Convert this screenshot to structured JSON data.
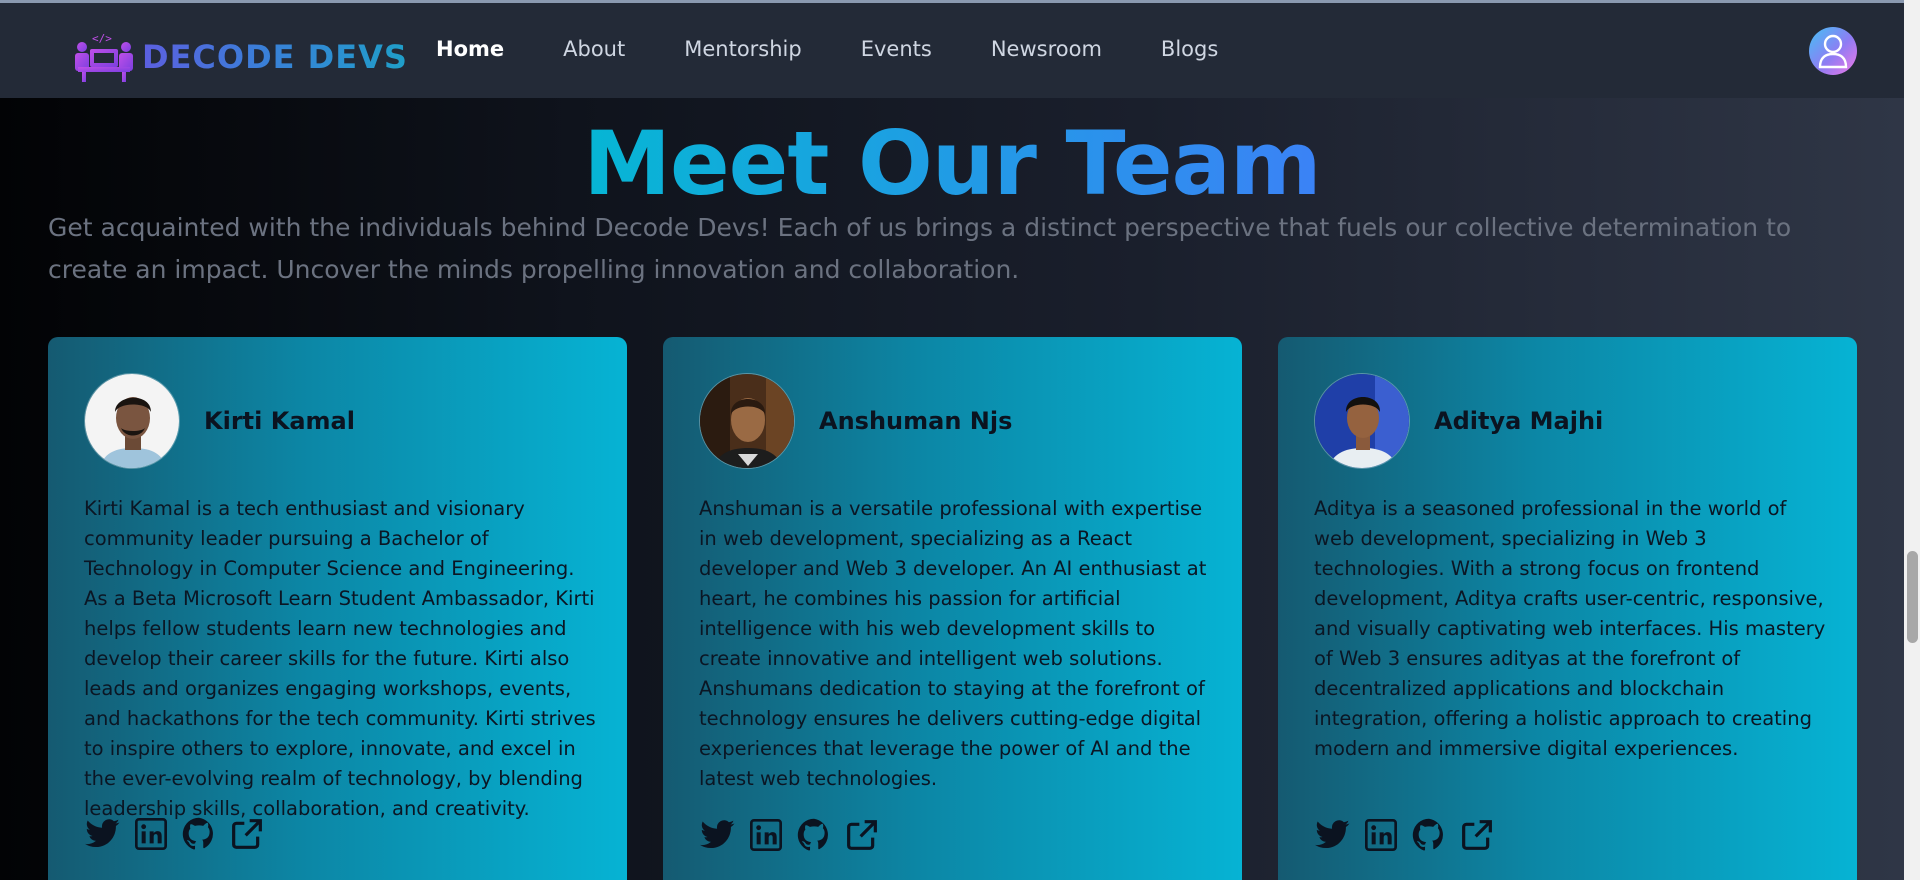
{
  "nav": {
    "brand": "DECODE DEVS",
    "links": [
      {
        "label": "Home",
        "active": true
      },
      {
        "label": "About",
        "active": false
      },
      {
        "label": "Mentorship",
        "active": false
      },
      {
        "label": "Events",
        "active": false
      },
      {
        "label": "Newsroom",
        "active": false
      },
      {
        "label": "Blogs",
        "active": false
      }
    ],
    "user_icon": "user-icon"
  },
  "section": {
    "title": "Meet Our Team",
    "subtitle": "Get acquainted with the individuals behind Decode Devs! Each of us brings a distinct perspective that fuels our collective determination to create an impact. Uncover the minds propelling innovation and collaboration."
  },
  "team": [
    {
      "name": "Kirti Kamal",
      "bio": "Kirti Kamal is a tech enthusiast and visionary community leader pursuing a Bachelor of Technology in Computer Science and Engineering. As a Beta Microsoft Learn Student Ambassador, Kirti helps fellow students learn new technologies and develop their career skills for the future. Kirti also leads and organizes engaging workshops, events, and hackathons for the tech community. Kirti strives to inspire others to explore, innovate, and excel in the ever-evolving realm of technology, by blending leadership skills, collaboration, and creativity.",
      "socials": [
        "twitter-icon",
        "linkedin-icon",
        "github-icon",
        "external-link-icon"
      ]
    },
    {
      "name": "Anshuman Njs",
      "bio": "Anshuman is a versatile professional with expertise in web development, specializing as a React developer and Web 3 developer. An AI enthusiast at heart, he combines his passion for artificial intelligence with his web development skills to create innovative and intelligent web solutions. Anshumans dedication to staying at the forefront of technology ensures he delivers cutting-edge digital experiences that leverage the power of AI and the latest web technologies.",
      "socials": [
        "twitter-icon",
        "linkedin-icon",
        "github-icon",
        "external-link-icon"
      ]
    },
    {
      "name": "Aditya Majhi",
      "bio": "Aditya is a seasoned professional in the world of web development, specializing in Web 3 technologies. With a strong focus on frontend development, Aditya crafts user-centric, responsive, and visually captivating web interfaces. His mastery of Web 3 ensures adityas at the forefront of decentralized applications and blockchain integration, offering a holistic approach to creating modern and immersive digital experiences.",
      "socials": [
        "twitter-icon",
        "linkedin-icon",
        "github-icon",
        "external-link-icon"
      ]
    }
  ],
  "colors": {
    "accent_start": "#06b6d4",
    "accent_end": "#3b82f6",
    "card_start": "#155a71",
    "card_end": "#06b3d4"
  }
}
